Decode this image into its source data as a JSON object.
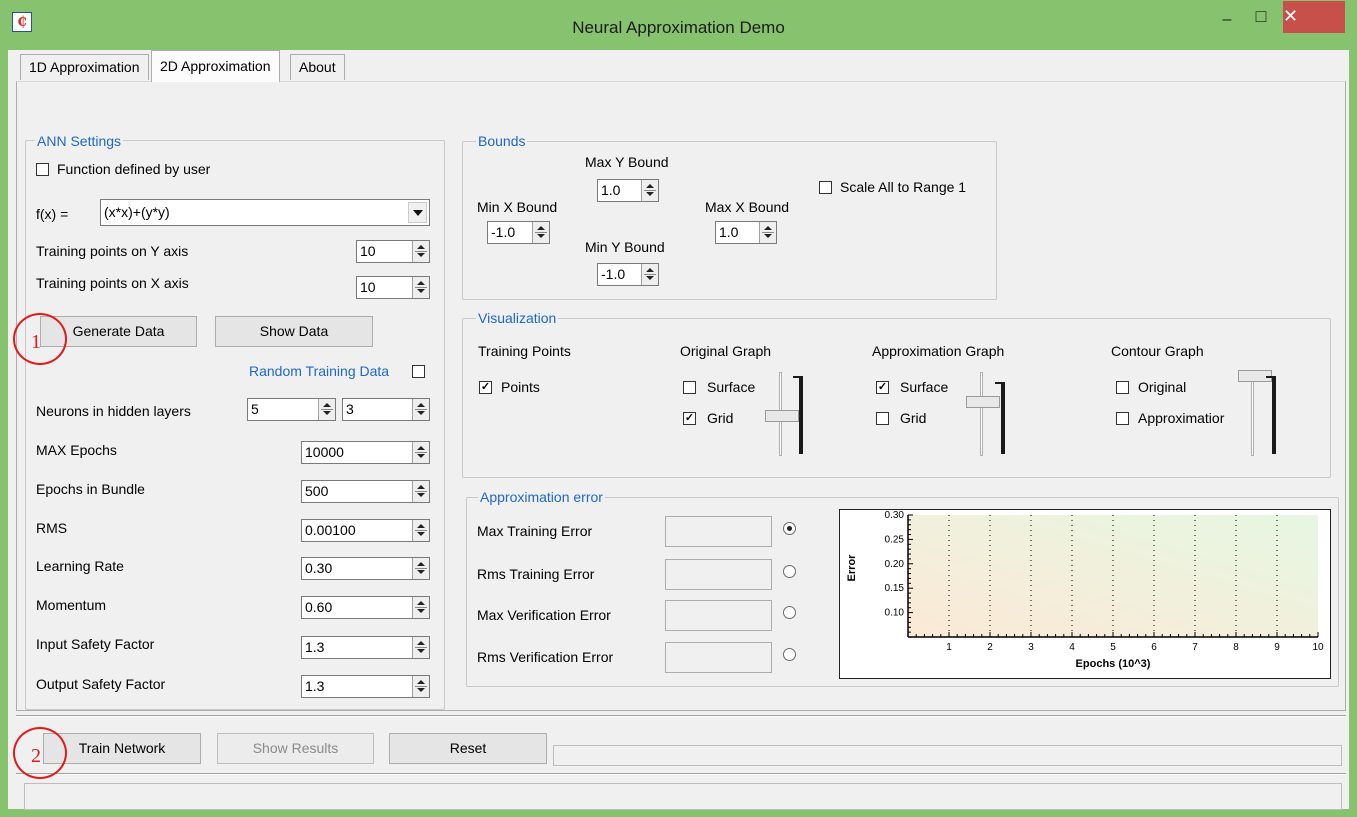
{
  "window": {
    "title": "Neural Approximation Demo",
    "icon_glyph": "₵",
    "minimize_glyph": "–",
    "maximize_glyph": "□",
    "close_glyph": "✕"
  },
  "tabs": [
    {
      "label": "1D Approximation",
      "active": false
    },
    {
      "label": "2D Approximation",
      "active": true
    },
    {
      "label": "About",
      "active": false
    }
  ],
  "ann_settings": {
    "legend": "ANN Settings",
    "function_defined_by_user": {
      "label": "Function defined by user",
      "checked": false
    },
    "fx_label": "f(x) =",
    "fx_value": "(x*x)+(y*y)",
    "training_points_y": {
      "label": "Training points on Y axis",
      "value": "10"
    },
    "training_points_x": {
      "label": "Training points on X axis",
      "value": "10"
    },
    "generate_data": "Generate Data",
    "show_data": "Show Data",
    "random_training_data": {
      "label": "Random Training Data",
      "checked": false
    },
    "neurons_hidden": {
      "label": "Neurons in hidden layers",
      "value1": "5",
      "value2": "3"
    },
    "max_epochs": {
      "label": "MAX Epochs",
      "value": "10000"
    },
    "epochs_in_bundle": {
      "label": "Epochs in Bundle",
      "value": "500"
    },
    "rms": {
      "label": "RMS",
      "value": "0.00100"
    },
    "learning_rate": {
      "label": "Learning Rate",
      "value": "0.30"
    },
    "momentum": {
      "label": "Momentum",
      "value": "0.60"
    },
    "input_safety": {
      "label": "Input Safety Factor",
      "value": "1.3"
    },
    "output_safety": {
      "label": "Output Safety Factor",
      "value": "1.3"
    }
  },
  "bounds": {
    "legend": "Bounds",
    "max_y": {
      "label": "Max Y Bound",
      "value": "1.0"
    },
    "min_x": {
      "label": "Min X Bound",
      "value": "-1.0"
    },
    "max_x": {
      "label": "Max X Bound",
      "value": "1.0"
    },
    "min_y": {
      "label": "Min Y Bound",
      "value": "-1.0"
    },
    "scale_all": {
      "label": "Scale All to Range 1",
      "checked": false
    }
  },
  "visualization": {
    "legend": "Visualization",
    "training_points": {
      "heading": "Training Points",
      "points": {
        "label": "Points",
        "checked": true
      }
    },
    "original_graph": {
      "heading": "Original Graph",
      "surface": {
        "label": "Surface",
        "checked": false
      },
      "grid": {
        "label": "Grid",
        "checked": true
      }
    },
    "approximation_graph": {
      "heading": "Approximation Graph",
      "surface": {
        "label": "Surface",
        "checked": true
      },
      "grid": {
        "label": "Grid",
        "checked": false
      }
    },
    "contour_graph": {
      "heading": "Contour Graph",
      "original": {
        "label": "Original",
        "checked": false
      },
      "approximation": {
        "label": "Approximatior",
        "checked": false
      }
    }
  },
  "approximation_error": {
    "legend": "Approximation error",
    "rows": [
      {
        "label": "Max Training Error",
        "value": "",
        "selected": true
      },
      {
        "label": "Rms Training Error",
        "value": "",
        "selected": false
      },
      {
        "label": "Max Verification Error",
        "value": "",
        "selected": false
      },
      {
        "label": "Rms Verification Error",
        "value": "",
        "selected": false
      }
    ]
  },
  "chart_data": {
    "type": "line",
    "title": "",
    "xlabel": "Epochs (10^3)",
    "ylabel": "Error",
    "xlim": [
      0,
      10
    ],
    "ylim": [
      0.05,
      0.3
    ],
    "x_ticks": [
      "1",
      "2",
      "3",
      "4",
      "5",
      "6",
      "7",
      "8",
      "9",
      "10"
    ],
    "y_ticks": [
      "0.10",
      "0.15",
      "0.20",
      "0.25",
      "0.30"
    ],
    "grid": "vertical dotted",
    "series": []
  },
  "bottom": {
    "train_network": "Train Network",
    "show_results": "Show Results",
    "reset": "Reset"
  },
  "annotations": {
    "one": "1",
    "two": "2"
  },
  "colors": {
    "accent": "#1e67c9",
    "frame": "#87c36e",
    "close": "#c7504b",
    "annotation": "#e21a1a"
  }
}
